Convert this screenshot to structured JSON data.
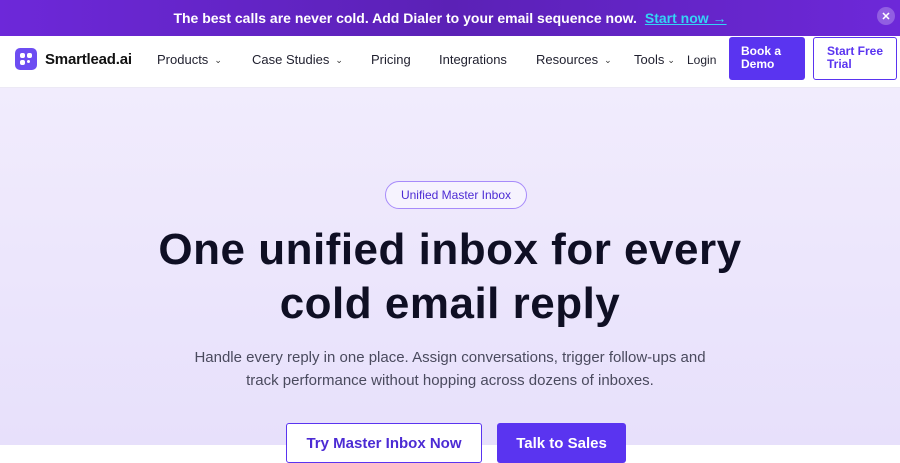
{
  "banner": {
    "message": "The best calls are never cold. Add Dialer to your email sequence now.",
    "cta": "Start now →",
    "close_icon": "close-icon"
  },
  "nav": {
    "logo_text": "Smartlead.ai",
    "items": [
      {
        "label": "Products",
        "has_chevron": true
      },
      {
        "label": "Case Studies",
        "has_chevron": true
      },
      {
        "label": "Pricing",
        "has_chevron": false
      },
      {
        "label": "Integrations",
        "has_chevron": false
      },
      {
        "label": "Resources",
        "has_chevron": true
      },
      {
        "label": "Tools",
        "has_chevron": true
      }
    ],
    "login": "Login",
    "book_demo": "Book a Demo",
    "free_trial": "Start Free Trial"
  },
  "hero": {
    "pill": "Unified Master Inbox",
    "title_line1": "One unified inbox for every",
    "title_line2": "cold email reply",
    "subtitle_line1": "Handle every reply in one place. Assign conversations, trigger follow-ups and",
    "subtitle_line2": "track performance without hopping across dozens of inboxes.",
    "primary_cta": "Try Master Inbox Now",
    "secondary_cta": "Talk to Sales"
  },
  "colors": {
    "brand": "#5a34f0",
    "banner": "#6d28d9",
    "banner_link": "#34d3f5",
    "hero_bg": "#ede7fc"
  }
}
